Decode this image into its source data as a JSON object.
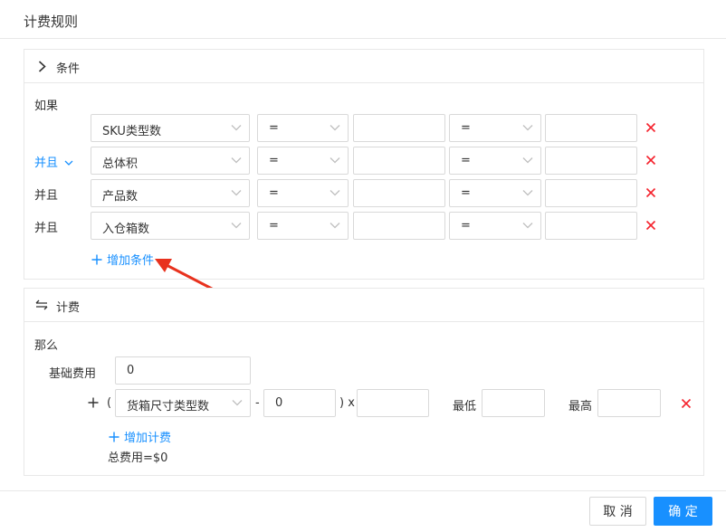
{
  "dialog": {
    "title": "计费规则"
  },
  "conditions": {
    "section_label": "条件",
    "if_label": "如果",
    "rows": [
      {
        "connector": "",
        "field": "SKU类型数",
        "op1": "=",
        "value1": "",
        "op2": "=",
        "value2": ""
      },
      {
        "connector": "并且",
        "field": "总体积",
        "op1": "=",
        "value1": "",
        "op2": "=",
        "value2": ""
      },
      {
        "connector": "并且",
        "field": "产品数",
        "op1": "=",
        "value1": "",
        "op2": "=",
        "value2": ""
      },
      {
        "connector": "并且",
        "field": "入仓箱数",
        "op1": "=",
        "value1": "",
        "op2": "=",
        "value2": ""
      }
    ],
    "add_label": "增加条件"
  },
  "billing": {
    "section_label": "计费",
    "then_label": "那么",
    "base_fee_label": "基础费用",
    "base_fee_value": "0",
    "formula": {
      "plus": "+",
      "open_paren": "(",
      "field": "货箱尺寸类型数",
      "minus": "-",
      "offset_value": "0",
      "close_times": ") x",
      "multiplier_value": "",
      "min_label": "最低",
      "min_value": "",
      "max_label": "最高",
      "max_value": ""
    },
    "add_label": "增加计费",
    "total_label": "总费用=$0"
  },
  "footer": {
    "cancel_label": "取 消",
    "ok_label": "确 定"
  },
  "colors": {
    "primary": "#1890ff",
    "danger": "#f5222d",
    "annotation": "#e8321e",
    "border": "#d9d9d9"
  }
}
